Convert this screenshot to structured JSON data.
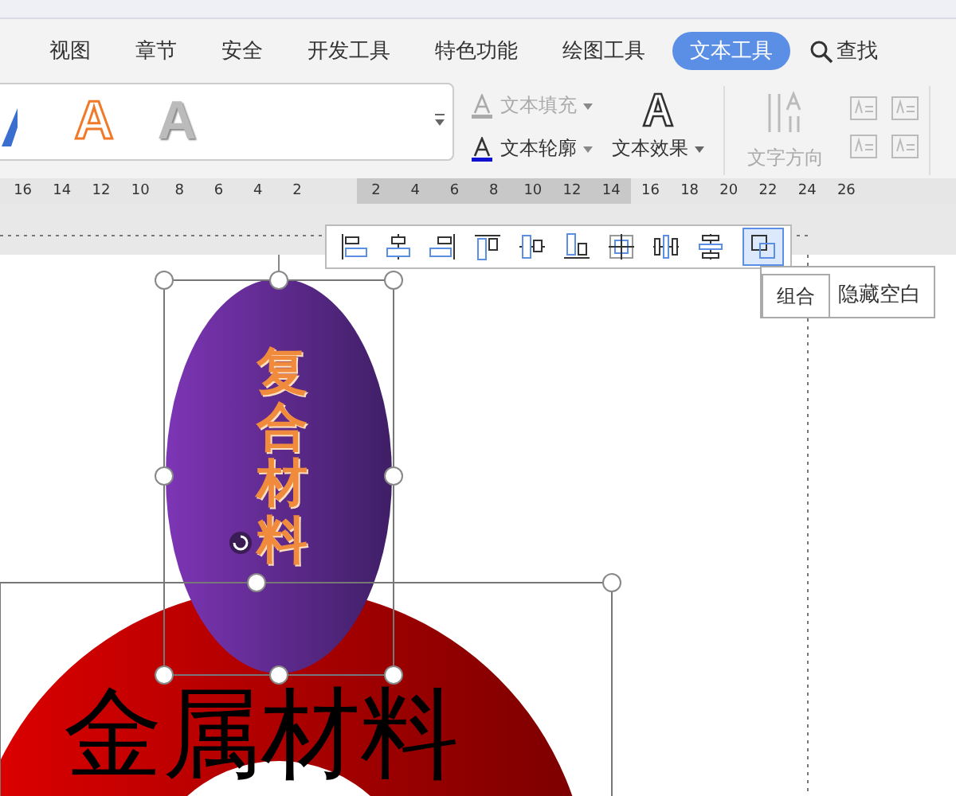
{
  "tabs": [
    {
      "label": "视图",
      "selected": false
    },
    {
      "label": "章节",
      "selected": false
    },
    {
      "label": "安全",
      "selected": false
    },
    {
      "label": "开发工具",
      "selected": false
    },
    {
      "label": "特色功能",
      "selected": false
    },
    {
      "label": "绘图工具",
      "selected": false
    },
    {
      "label": "文本工具",
      "selected": true
    }
  ],
  "search": {
    "label": "查找"
  },
  "style_gallery": [
    {
      "text": "A",
      "kind": "orange-outline"
    },
    {
      "text": "A",
      "kind": "silver"
    }
  ],
  "text_buttons": [
    {
      "label": "文本填充",
      "disabled": true
    },
    {
      "label": "文本轮廓",
      "disabled": false
    }
  ],
  "text_effect": {
    "label": "文本效果"
  },
  "text_direction": {
    "label": "文字方向",
    "disabled": true
  },
  "ruler": [
    {
      "label": "16",
      "active": false
    },
    {
      "label": "14",
      "active": false
    },
    {
      "label": "12",
      "active": false
    },
    {
      "label": "10",
      "active": false
    },
    {
      "label": "8",
      "active": false
    },
    {
      "label": "6",
      "active": false
    },
    {
      "label": "4",
      "active": false
    },
    {
      "label": "2",
      "active": false
    },
    {
      "label": "2",
      "active": true
    },
    {
      "label": "4",
      "active": true
    },
    {
      "label": "6",
      "active": true
    },
    {
      "label": "8",
      "active": true
    },
    {
      "label": "10",
      "active": true
    },
    {
      "label": "12",
      "active": true
    },
    {
      "label": "14",
      "active": true
    },
    {
      "label": "16",
      "active": false
    },
    {
      "label": "18",
      "active": false
    },
    {
      "label": "20",
      "active": false
    },
    {
      "label": "22",
      "active": false
    },
    {
      "label": "24",
      "active": false
    },
    {
      "label": "26",
      "active": false
    }
  ],
  "align_toolbar": [
    {
      "kind": "left",
      "selected": false
    },
    {
      "kind": "center",
      "selected": false
    },
    {
      "kind": "right",
      "selected": false
    },
    {
      "kind": "top",
      "selected": false
    },
    {
      "kind": "middle",
      "selected": false
    },
    {
      "kind": "bottom",
      "selected": false
    },
    {
      "kind": "center-both",
      "selected": false
    },
    {
      "kind": "distribute-h",
      "selected": false
    },
    {
      "kind": "distribute-v",
      "selected": false
    },
    {
      "kind": "group",
      "selected": true
    }
  ],
  "tooltip": "组合",
  "hint": "隐藏空白",
  "canvas": {
    "ellipse_text": "复合材料",
    "title_text": "金属材料"
  }
}
